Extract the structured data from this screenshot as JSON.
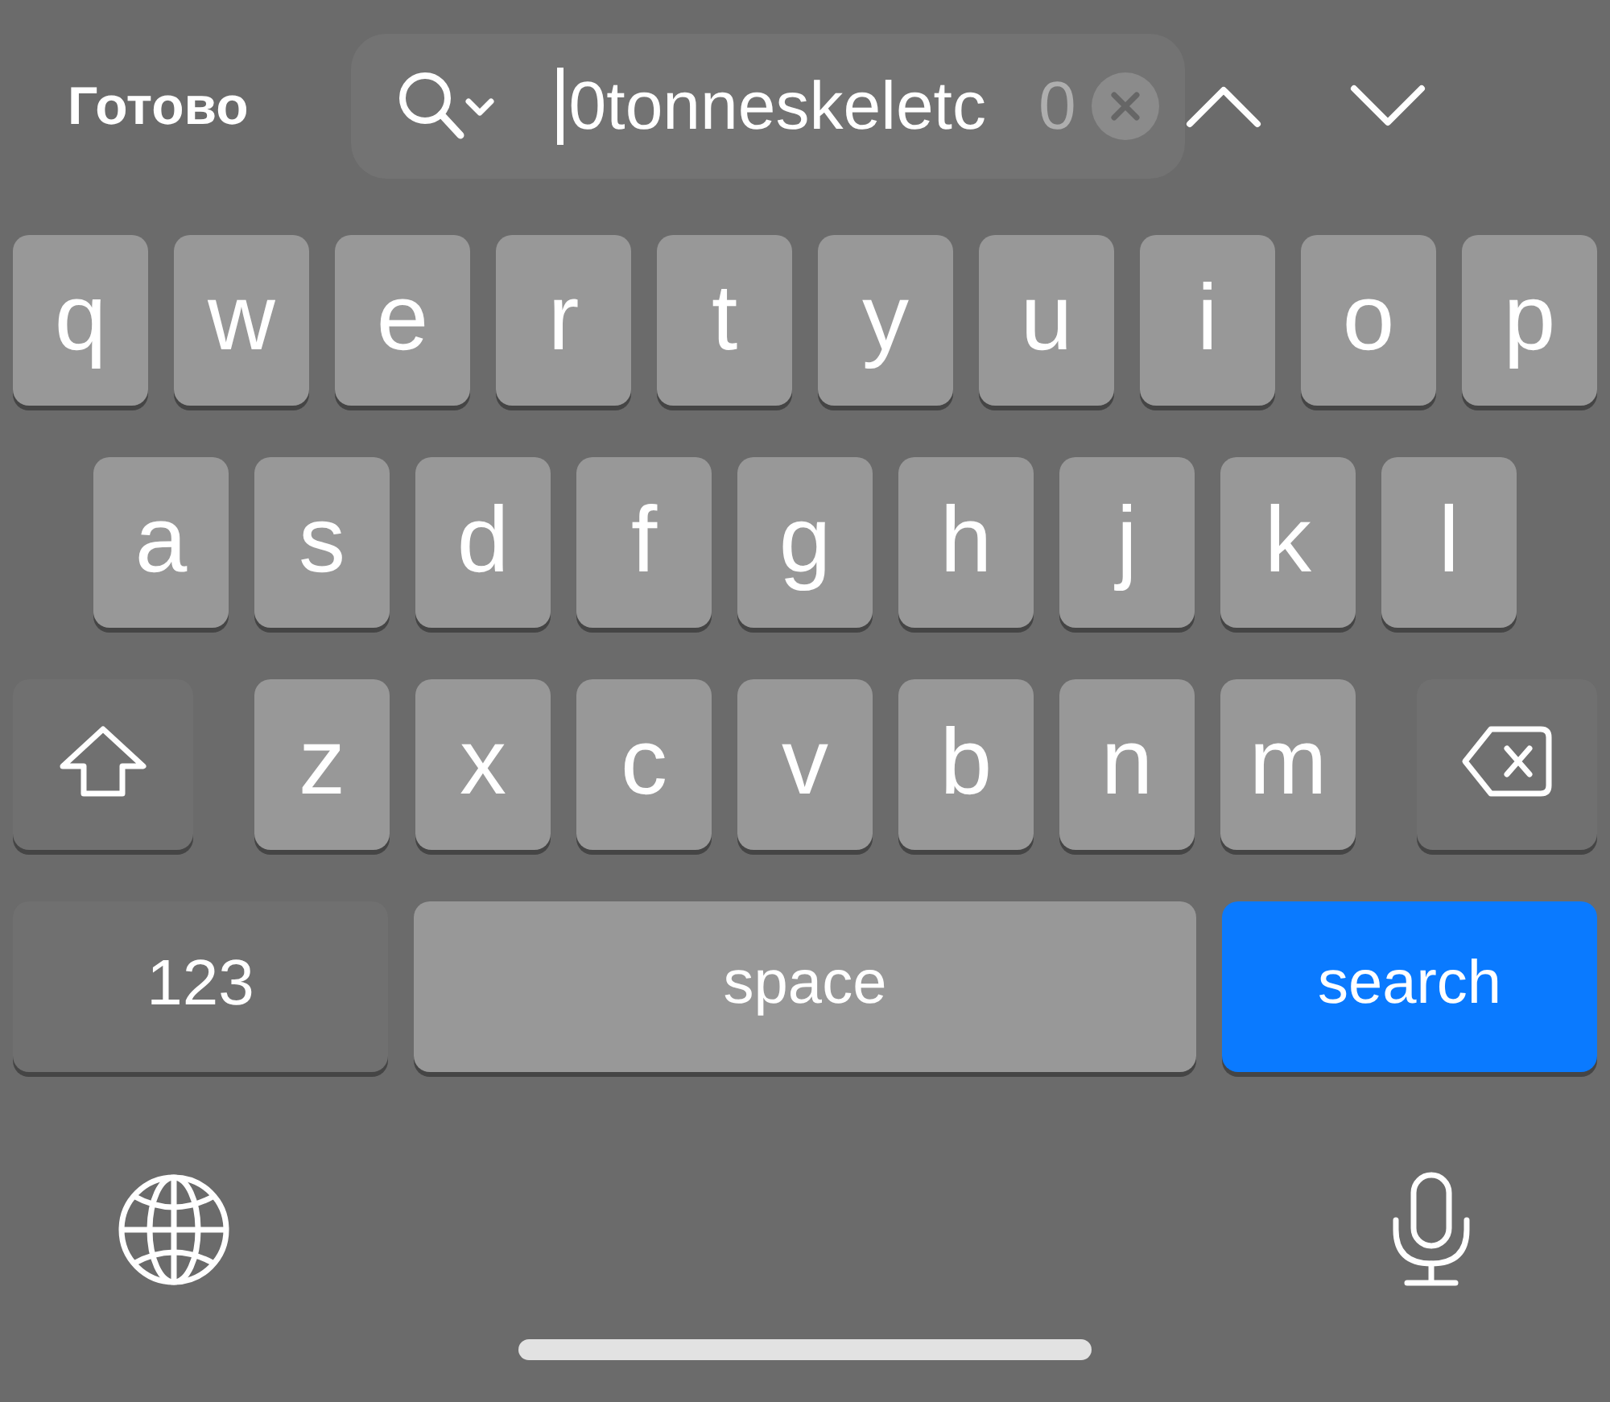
{
  "toolbar": {
    "done_label": "Готово",
    "search": {
      "value": "0tonneskeletc",
      "match_count": "0"
    }
  },
  "keyboard": {
    "rows": [
      {
        "keys": [
          {
            "kind": "letter",
            "label": "q"
          },
          {
            "kind": "letter",
            "label": "w"
          },
          {
            "kind": "letter",
            "label": "e"
          },
          {
            "kind": "letter",
            "label": "r"
          },
          {
            "kind": "letter",
            "label": "t"
          },
          {
            "kind": "letter",
            "label": "y"
          },
          {
            "kind": "letter",
            "label": "u"
          },
          {
            "kind": "letter",
            "label": "i"
          },
          {
            "kind": "letter",
            "label": "o"
          },
          {
            "kind": "letter",
            "label": "p"
          }
        ]
      },
      {
        "keys": [
          {
            "kind": "letter",
            "label": "a"
          },
          {
            "kind": "letter",
            "label": "s"
          },
          {
            "kind": "letter",
            "label": "d"
          },
          {
            "kind": "letter",
            "label": "f"
          },
          {
            "kind": "letter",
            "label": "g"
          },
          {
            "kind": "letter",
            "label": "h"
          },
          {
            "kind": "letter",
            "label": "j"
          },
          {
            "kind": "letter",
            "label": "k"
          },
          {
            "kind": "letter",
            "label": "l"
          }
        ]
      },
      {
        "keys": [
          {
            "kind": "shift"
          },
          {
            "kind": "letter",
            "label": "z"
          },
          {
            "kind": "letter",
            "label": "x"
          },
          {
            "kind": "letter",
            "label": "c"
          },
          {
            "kind": "letter",
            "label": "v"
          },
          {
            "kind": "letter",
            "label": "b"
          },
          {
            "kind": "letter",
            "label": "n"
          },
          {
            "kind": "letter",
            "label": "m"
          },
          {
            "kind": "backspace"
          }
        ]
      },
      {
        "keys": [
          {
            "kind": "mode",
            "label": "123"
          },
          {
            "kind": "space",
            "label": "space"
          },
          {
            "kind": "action",
            "label": "search"
          }
        ]
      }
    ]
  }
}
